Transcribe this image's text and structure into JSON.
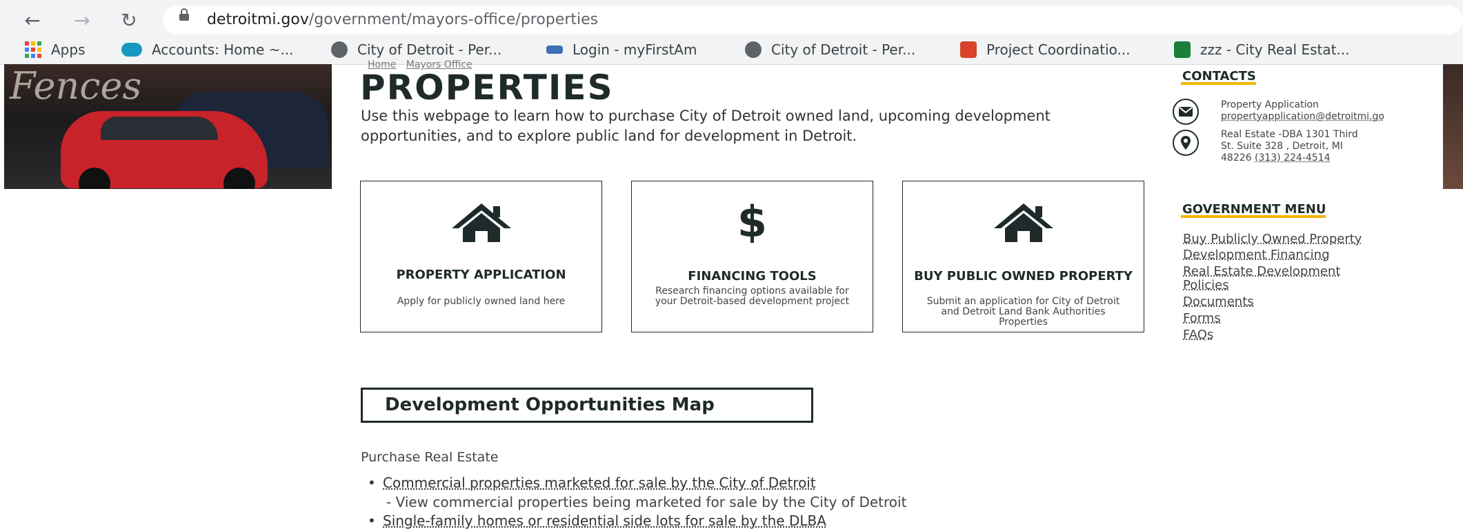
{
  "browser": {
    "url_domain": "detroitmi.gov",
    "url_path": "/government/mayors-office/properties",
    "bookmarks": [
      {
        "label": "Apps",
        "icon": "apps-grid-icon"
      },
      {
        "label": "Accounts: Home ~...",
        "icon": "salesforce-cloud-icon"
      },
      {
        "label": "City of Detroit - Per...",
        "icon": "globe-icon"
      },
      {
        "label": "Login - myFirstAm",
        "icon": "eagle-icon"
      },
      {
        "label": "City of Detroit - Per...",
        "icon": "globe-icon"
      },
      {
        "label": "Project Coordinatio...",
        "icon": "map-pin-icon"
      },
      {
        "label": "zzz - City Real Estat...",
        "icon": "green-swirl-icon"
      }
    ]
  },
  "page": {
    "breadcrumb": [
      "Home",
      "Mayors Office"
    ],
    "title": "PROPERTIES",
    "intro": "Use this webpage to learn how to purchase City of Detroit owned land, upcoming development opportunities, and to explore public land for development in Detroit."
  },
  "cards": [
    {
      "title": "PROPERTY APPLICATION",
      "desc": "Apply for publicly owned land here",
      "icon": "house-icon"
    },
    {
      "title": "FINANCING TOOLS",
      "desc": "Research  financing options available for your Detroit-based development project",
      "icon": "dollar-icon"
    },
    {
      "title": "BUY PUBLIC OWNED PROPERTY",
      "desc": "Submit an application for City of Detroit and Detroit Land Bank Authorities Properties",
      "icon": "house-icon"
    }
  ],
  "contacts": {
    "heading": "CONTACTS",
    "email_label": "Property Application",
    "email": "propertyapplication@detroitmi.go",
    "address_line1": "Real Estate -DBA 1301 Third",
    "address_line2": "St. Suite 328 , Detroit, MI",
    "address_zip": "48226",
    "phone": "(313) 224-4514"
  },
  "government_menu": {
    "heading": "GOVERNMENT MENU",
    "items": [
      "Buy Publicly Owned Property",
      "Development Financing",
      "Real Estate Development",
      "Policies",
      "Documents",
      "Forms",
      "FAQs"
    ]
  },
  "map_button": "Development Opportunities Map",
  "purchase": {
    "heading": "Purchase Real Estate",
    "items": [
      {
        "text": "Commercial properties marketed for sale by the City of Detroit",
        "sub": "- View commercial properties being marketed for sale by the City of Detroit"
      },
      {
        "text": "Single-family homes or residential side lots for sale by the DLBA"
      }
    ]
  },
  "colors": {
    "accent": "#f2b705",
    "dark": "#1f2a2a"
  }
}
